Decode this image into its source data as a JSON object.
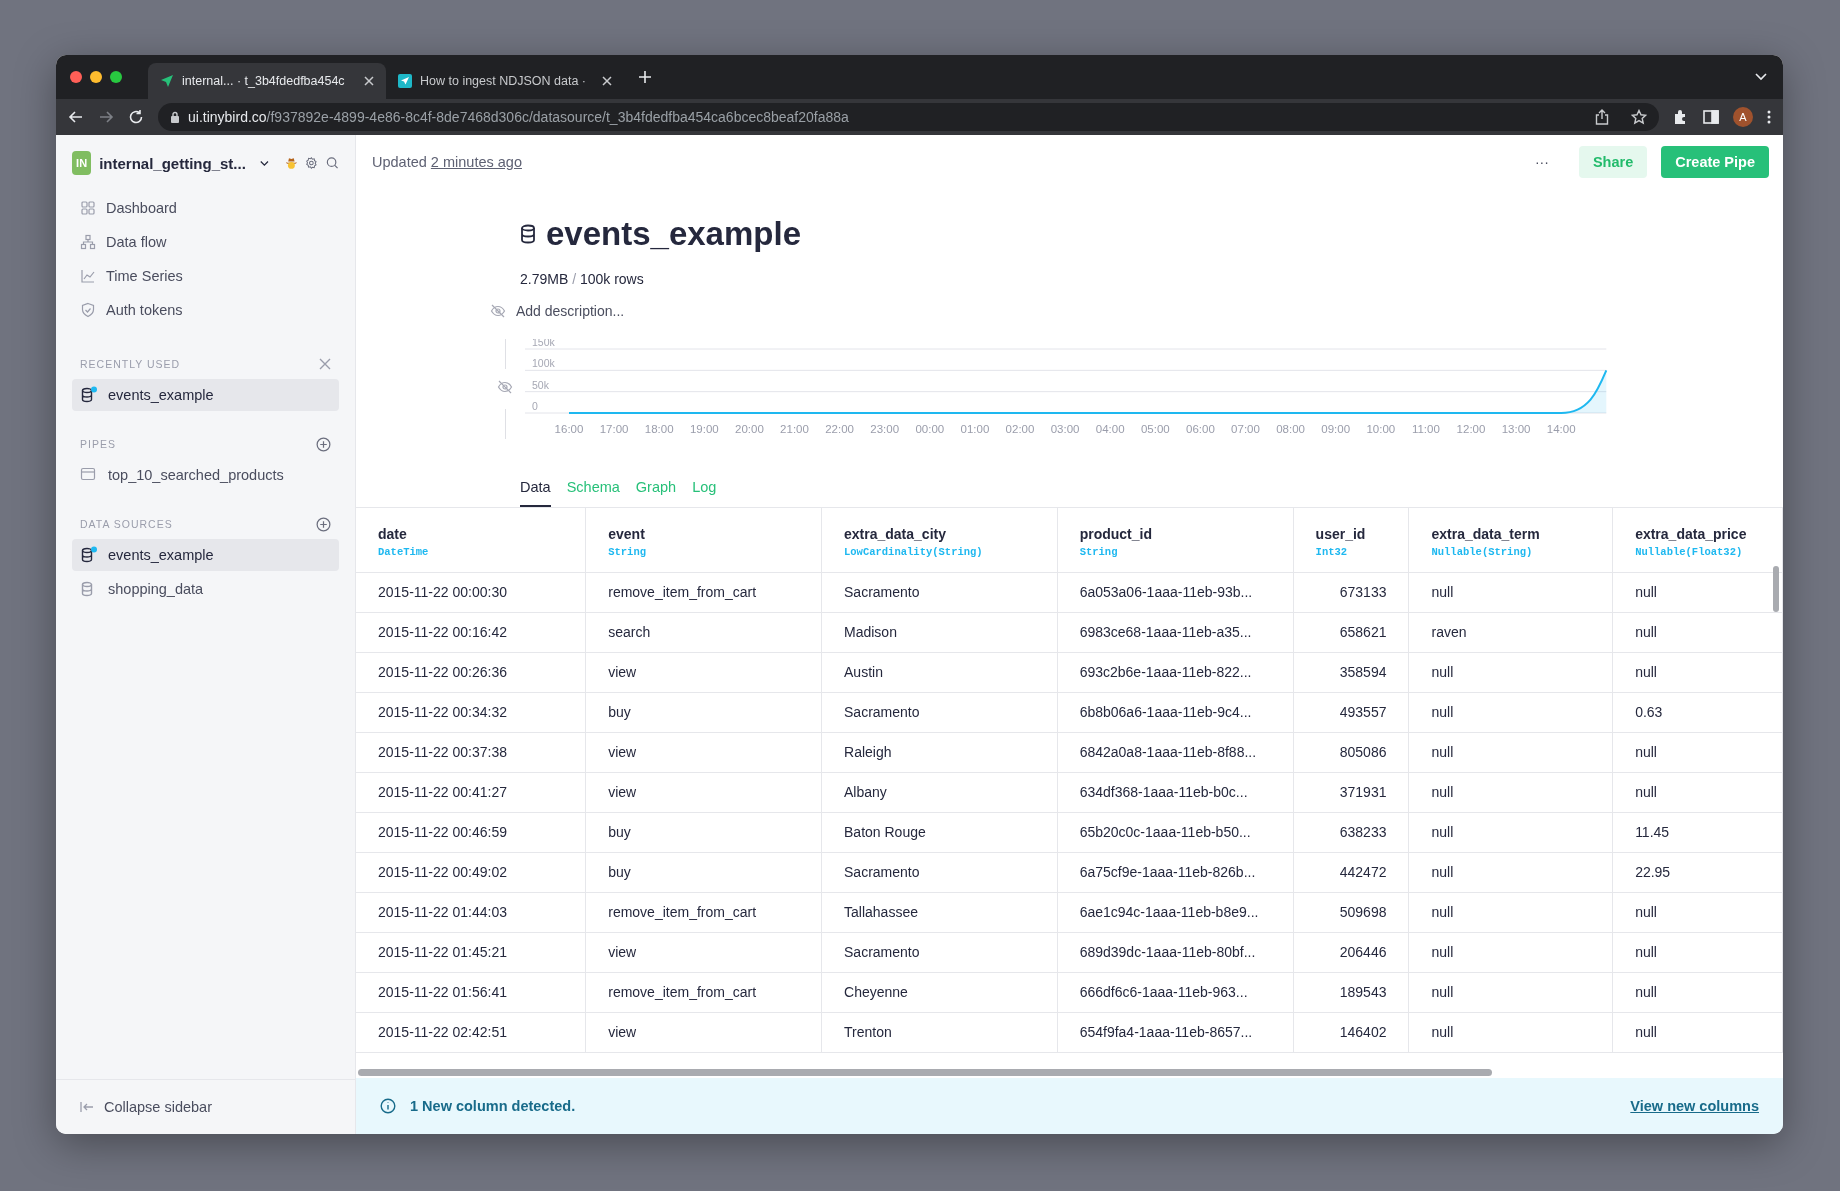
{
  "browser": {
    "tabs": [
      {
        "title": "internal... · t_3b4fdedfba454c",
        "selected": true
      },
      {
        "title": "How to ingest NDJSON data ·",
        "selected": false
      }
    ],
    "address": {
      "host": "ui.tinybird.co",
      "path": "/f937892e-4899-4e86-8c4f-8de7468d306c/datasource/t_3b4fdedfba454ca6bcec8beaf20fa88a"
    },
    "avatar": "A"
  },
  "sidebar": {
    "workspace": {
      "badge": "IN",
      "name": "internal_getting_st..."
    },
    "nav": [
      {
        "label": "Dashboard"
      },
      {
        "label": "Data flow"
      },
      {
        "label": "Time Series"
      },
      {
        "label": "Auth tokens"
      }
    ],
    "sections": [
      {
        "title": "RECENTLY USED",
        "kind": "recent",
        "items": [
          {
            "label": "events_example",
            "kind": "datasource",
            "indicator": true,
            "selected": true
          }
        ]
      },
      {
        "title": "PIPES",
        "kind": "add",
        "items": [
          {
            "label": "top_10_searched_products",
            "kind": "pipe",
            "indicator": false,
            "selected": false
          }
        ]
      },
      {
        "title": "DATA SOURCES",
        "kind": "add",
        "items": [
          {
            "label": "events_example",
            "kind": "datasource",
            "indicator": true,
            "selected": true
          },
          {
            "label": "shopping_data",
            "kind": "datasource",
            "indicator": false,
            "selected": false
          }
        ]
      }
    ],
    "collapse": "Collapse sidebar"
  },
  "header": {
    "updated_prefix": "Updated",
    "updated_link": "2 minutes ago",
    "more": "···",
    "share": "Share",
    "create": "Create Pipe"
  },
  "datasource": {
    "title": "events_example",
    "size": "2.79MB",
    "separator": "/",
    "rows": "100k rows",
    "description_placeholder": "Add description...",
    "chart_data": {
      "type": "area",
      "categories": [
        "16:00",
        "17:00",
        "18:00",
        "19:00",
        "20:00",
        "21:00",
        "22:00",
        "23:00",
        "00:00",
        "01:00",
        "02:00",
        "03:00",
        "04:00",
        "05:00",
        "06:00",
        "07:00",
        "08:00",
        "09:00",
        "10:00",
        "11:00",
        "12:00",
        "13:00",
        "14:00",
        null
      ],
      "series": [
        {
          "color": "#1eb8f0",
          "values": [
            0,
            0,
            0,
            0,
            0,
            0,
            0,
            0,
            0,
            0,
            0,
            0,
            0,
            0,
            0,
            0,
            0,
            0,
            0,
            0,
            0,
            0,
            0,
            100000
          ]
        }
      ],
      "ylim": [
        0,
        150000
      ],
      "yticks": [
        {
          "value": 0,
          "label": "0"
        },
        {
          "value": 50000,
          "label": "50k"
        },
        {
          "value": 100000,
          "label": "100k"
        },
        {
          "value": 150000,
          "label": "150k"
        }
      ]
    }
  },
  "tabs": [
    {
      "label": "Data",
      "selected": true
    },
    {
      "label": "Schema",
      "selected": false
    },
    {
      "label": "Graph",
      "selected": false
    },
    {
      "label": "Log",
      "selected": false
    }
  ],
  "table": {
    "columns": [
      {
        "name": "date",
        "type": "DateTime"
      },
      {
        "name": "event",
        "type": "String"
      },
      {
        "name": "extra_data_city",
        "type": "LowCardinality(String)"
      },
      {
        "name": "product_id",
        "type": "String"
      },
      {
        "name": "user_id",
        "type": "Int32"
      },
      {
        "name": "extra_data_term",
        "type": "Nullable(String)"
      },
      {
        "name": "extra_data_price",
        "type": "Nullable(Float32)"
      }
    ],
    "rows": [
      [
        "2015-11-22 00:00:30",
        "remove_item_from_cart",
        "Sacramento",
        "6a053a06-1aaa-11eb-93b...",
        "673133",
        "null",
        "null"
      ],
      [
        "2015-11-22 00:16:42",
        "search",
        "Madison",
        "6983ce68-1aaa-11eb-a35...",
        "658621",
        "raven",
        "null"
      ],
      [
        "2015-11-22 00:26:36",
        "view",
        "Austin",
        "693c2b6e-1aaa-11eb-822...",
        "358594",
        "null",
        "null"
      ],
      [
        "2015-11-22 00:34:32",
        "buy",
        "Sacramento",
        "6b8b06a6-1aaa-11eb-9c4...",
        "493557",
        "null",
        "0.63"
      ],
      [
        "2015-11-22 00:37:38",
        "view",
        "Raleigh",
        "6842a0a8-1aaa-11eb-8f88...",
        "805086",
        "null",
        "null"
      ],
      [
        "2015-11-22 00:41:27",
        "view",
        "Albany",
        "634df368-1aaa-11eb-b0c...",
        "371931",
        "null",
        "null"
      ],
      [
        "2015-11-22 00:46:59",
        "buy",
        "Baton Rouge",
        "65b20c0c-1aaa-11eb-b50...",
        "638233",
        "null",
        "11.45"
      ],
      [
        "2015-11-22 00:49:02",
        "buy",
        "Sacramento",
        "6a75cf9e-1aaa-11eb-826b...",
        "442472",
        "null",
        "22.95"
      ],
      [
        "2015-11-22 01:44:03",
        "remove_item_from_cart",
        "Tallahassee",
        "6ae1c94c-1aaa-11eb-b8e9...",
        "509698",
        "null",
        "null"
      ],
      [
        "2015-11-22 01:45:21",
        "view",
        "Sacramento",
        "689d39dc-1aaa-11eb-80bf...",
        "206446",
        "null",
        "null"
      ],
      [
        "2015-11-22 01:56:41",
        "remove_item_from_cart",
        "Cheyenne",
        "666df6c6-1aaa-11eb-963...",
        "189543",
        "null",
        "null"
      ],
      [
        "2015-11-22 02:42:51",
        "view",
        "Trenton",
        "654f9fa4-1aaa-11eb-8657...",
        "146402",
        "null",
        "null"
      ]
    ]
  },
  "banner": {
    "message": "1 New column detected.",
    "link": "View new columns"
  }
}
